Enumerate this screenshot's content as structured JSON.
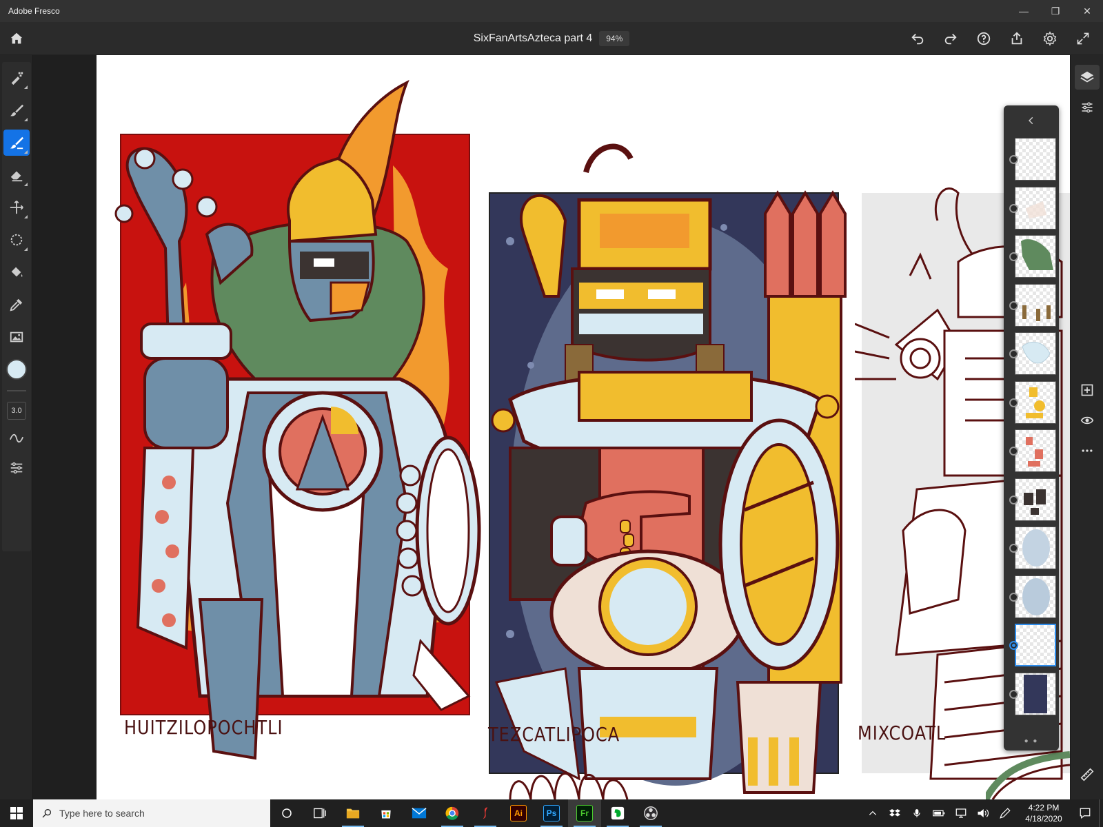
{
  "window": {
    "app_name": "Adobe Fresco",
    "minimize": "—",
    "maximize": "❐",
    "close": "✕"
  },
  "header": {
    "doc_title": "SixFanArtsAzteca part 4",
    "zoom": "94%"
  },
  "toolbar": {
    "brush_size": "3.0",
    "current_color": "#d7eaf3",
    "active_tool": "live-brush"
  },
  "artwork": {
    "labels": [
      "HUITZILOPOCHTLI",
      "TEZCATLIPOCA",
      "MIXCOATL"
    ],
    "colors": {
      "red_bg": "#c8120f",
      "navy_bg": "#33375a",
      "grey_bg": "#e9e9e9",
      "outline": "#5a1010",
      "skin_blue": "#6f8fa8",
      "light_blue": "#d7eaf3",
      "gold": "#f1bd2e",
      "orange": "#f29a2e",
      "salmon": "#e0705f",
      "green": "#5f8a5e",
      "dark": "#3b3331"
    }
  },
  "layers": {
    "count": 12,
    "selected_index": 10,
    "pager": "● ●"
  },
  "taskbar": {
    "search_placeholder": "Type here to search",
    "time": "4:22 PM",
    "date": "4/18/2020"
  }
}
